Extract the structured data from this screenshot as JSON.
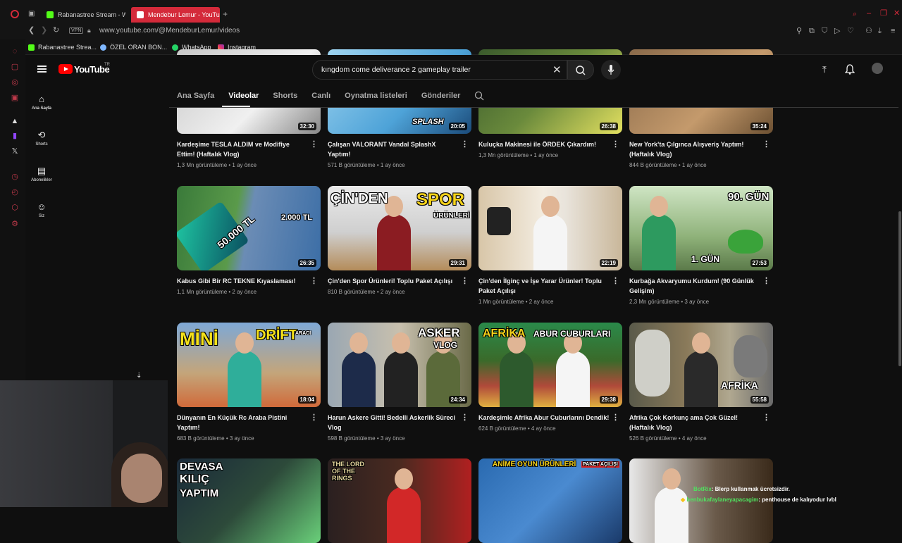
{
  "browser": {
    "tabs": [
      {
        "title": "Rabanastree Stream - Wa",
        "active": false
      },
      {
        "title": "Mendebur Lemur - YouTu",
        "active": true
      }
    ],
    "new_tab_label": "+",
    "url": "www.youtube.com/@MendeburLemur/videos",
    "vpn_label": "VPN",
    "bookmarks": [
      "Rabanastree Strea...",
      "ÖZEL ORAN BON...",
      "WhatsApp",
      "Instagram"
    ]
  },
  "youtube": {
    "logo_text": "YouTube",
    "region": "TR",
    "search_value": "kıngdom come deliverance 2 gameplay trailer",
    "guide": [
      {
        "label": "Ana Sayfa",
        "icon": "home-icon"
      },
      {
        "label": "Shorts",
        "icon": "shorts-icon"
      },
      {
        "label": "Abonelikler",
        "icon": "subscriptions-icon"
      },
      {
        "label": "Siz",
        "icon": "you-icon"
      }
    ],
    "channel_tabs": [
      "Ana Sayfa",
      "Videolar",
      "Shorts",
      "Canlı",
      "Oynatma listeleri",
      "Gönderiler"
    ],
    "selected_tab": "Videolar",
    "videos": [
      {
        "title": "Kardeşime TESLA ALDIM ve Modifiye Ettim! (Haftalık Vlog)",
        "views": "1,3 Mn görüntüleme",
        "age": "1 ay önce",
        "duration": "32:30",
        "overlay": ""
      },
      {
        "title": "Çalışan VALORANT Vandal SplashX Yaptım!",
        "views": "571 B görüntüleme",
        "age": "1 ay önce",
        "duration": "20:05",
        "overlay": "SPLASH"
      },
      {
        "title": "Kuluçka Makinesi ile ÖRDEK Çıkardım!",
        "views": "1,3 Mn görüntüleme",
        "age": "1 ay önce",
        "duration": "26:38",
        "overlay": ""
      },
      {
        "title": "New York'ta Çılgınca Alışveriş Yaptım! (Haftalık Vlog)",
        "views": "844 B görüntüleme",
        "age": "1 ay önce",
        "duration": "35:24",
        "overlay": ""
      },
      {
        "title": "Kabus Gibi Bir RC TEKNE Kıyaslaması!",
        "views": "1,1 Mn görüntüleme",
        "age": "2 ay önce",
        "duration": "26:35",
        "overlay": "50.000 TL",
        "overlay2": "2.000 TL"
      },
      {
        "title": "Çin'den Spor Ürünleri! Toplu Paket Açılışı",
        "views": "810 B görüntüleme",
        "age": "2 ay önce",
        "duration": "29:31",
        "overlay": "ÇİN'DEN",
        "overlay2": "SPOR",
        "overlay3": "ÜRÜNLERİ"
      },
      {
        "title": "Çin'den İlginç ve İşe Yarar Ürünler! Toplu Paket Açılışı",
        "views": "1 Mn görüntüleme",
        "age": "2 ay önce",
        "duration": "22:19",
        "overlay": ""
      },
      {
        "title": "Kurbağa Akvaryumu Kurdum! (90 Günlük Gelişim)",
        "views": "2,3 Mn görüntüleme",
        "age": "3 ay önce",
        "duration": "27:53",
        "overlay": "90. GÜN",
        "overlay2": "1. GÜN"
      },
      {
        "title": "Dünyanın En Küçük Rc Araba Pistini Yaptım!",
        "views": "683 B görüntüleme",
        "age": "3 ay önce",
        "duration": "18:04",
        "overlay": "MİNİ",
        "overlay2": "DRİFT",
        "overlay3": "ARACI"
      },
      {
        "title": "Harun Askere Gitti! Bedelli Askerlik Süreci Vlog",
        "views": "598 B görüntüleme",
        "age": "3 ay önce",
        "duration": "24:34",
        "overlay": "ASKER",
        "overlay2": "VLOG"
      },
      {
        "title": "Kardeşimle Afrika Abur Cuburlarını Dendik!",
        "views": "624 B görüntüleme",
        "age": "4 ay önce",
        "duration": "29:38",
        "overlay": "AFRİKA",
        "overlay2": "ABUR CUBURLARI"
      },
      {
        "title": "Afrika Çok Korkunç ama Çok Güzel! (Haftalık Vlog)",
        "views": "526 B görüntüleme",
        "age": "4 ay önce",
        "duration": "55:58",
        "overlay": "AFRİKA"
      },
      {
        "title": "",
        "views": "",
        "age": "",
        "duration": "",
        "overlay": "DEVASA",
        "overlay2": "KILIÇ",
        "overlay3": "YAPTIM"
      },
      {
        "title": "",
        "views": "",
        "age": "",
        "duration": "",
        "overlay": "THE LORD OF THE RINGS"
      },
      {
        "title": "",
        "views": "",
        "age": "",
        "duration": "",
        "overlay": "ANİME OYUN ÜRÜNLERİ",
        "overlay2": "PAKET AÇILIŞI"
      },
      {
        "title": "",
        "views": "",
        "age": "",
        "duration": "",
        "overlay": ""
      }
    ]
  },
  "chat": [
    {
      "user": "BotRix",
      "message": ": Blerp kullanmak ücretsizdir."
    },
    {
      "user": "benbukafaylaneyapacagim",
      "message": ": penthouse de kalıyodur lvbl"
    }
  ],
  "colors": {
    "accent_red": "#d42a3a",
    "yt_red": "#ff0000",
    "chat_user": "#4fe35f"
  }
}
